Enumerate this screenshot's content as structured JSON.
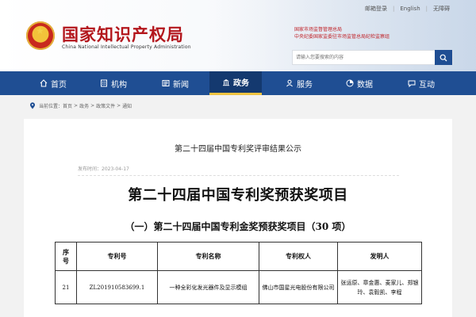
{
  "header": {
    "title": "国家知识产权局",
    "subtitle": "China National Intellectual Property Administration",
    "bureau_line1": "国家市场监督管理总局",
    "bureau_line2": "中央纪委国家监委驻市场监管总局纪检监察组",
    "top_links": [
      "邮箱登录",
      "English",
      "无障碍"
    ],
    "search": {
      "placeholder": "请输入您要搜索的内容",
      "icon": "search-icon"
    }
  },
  "nav": {
    "items": [
      {
        "label": "首页",
        "icon": "home-icon"
      },
      {
        "label": "机构",
        "icon": "building-icon"
      },
      {
        "label": "新闻",
        "icon": "news-icon"
      },
      {
        "label": "政务",
        "icon": "government-icon",
        "active": true
      },
      {
        "label": "服务",
        "icon": "service-icon"
      },
      {
        "label": "数据",
        "icon": "data-icon"
      },
      {
        "label": "互动",
        "icon": "chat-icon"
      }
    ],
    "accent": "#1f4e93",
    "active_underline": "#f0c341"
  },
  "breadcrumb": {
    "prefix": "当前位置：",
    "items": [
      "首页",
      "政务",
      "政策文件",
      "通知"
    ],
    "separator": ">"
  },
  "article": {
    "title": "第二十四届中国专利奖评审结果公示",
    "meta": "发布时间：2023-04-17",
    "heading": "第二十四届中国专利奖预获奖项目",
    "subheading": "（一）第二十四届中国专利金奖预获奖项目（30 项）",
    "table": {
      "headers": [
        "序号",
        "专利号",
        "专利名称",
        "专利权人",
        "发明人"
      ],
      "rows": [
        [
          "21",
          "ZL201910583699.1",
          "一种全彩化发光器件及显示模组",
          "佛山市国星光电股份有限公司",
          "张运原、章金惠、麦家儿、郑银玲、袁毅凯、李程"
        ]
      ]
    }
  }
}
